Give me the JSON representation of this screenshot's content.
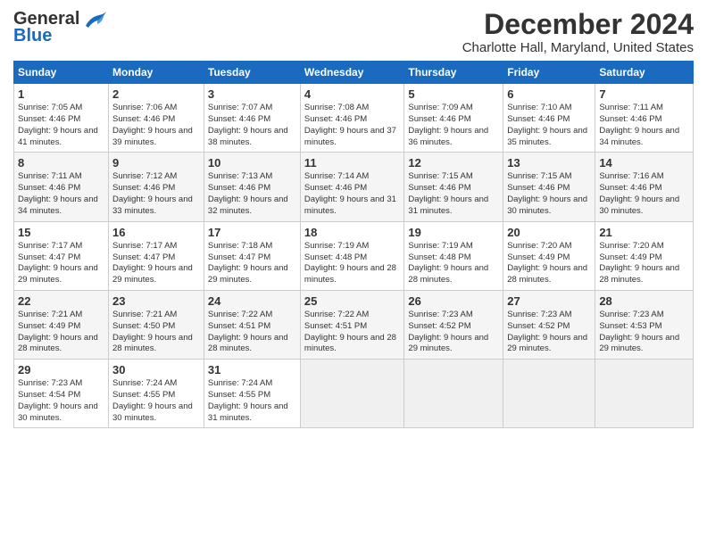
{
  "logo": {
    "line1": "General",
    "line2": "Blue"
  },
  "title": "December 2024",
  "subtitle": "Charlotte Hall, Maryland, United States",
  "days_header": [
    "Sunday",
    "Monday",
    "Tuesday",
    "Wednesday",
    "Thursday",
    "Friday",
    "Saturday"
  ],
  "rows": [
    [
      {
        "day": "1",
        "sunrise": "7:05 AM",
        "sunset": "4:46 PM",
        "daylight": "9 hours and 41 minutes."
      },
      {
        "day": "2",
        "sunrise": "7:06 AM",
        "sunset": "4:46 PM",
        "daylight": "9 hours and 39 minutes."
      },
      {
        "day": "3",
        "sunrise": "7:07 AM",
        "sunset": "4:46 PM",
        "daylight": "9 hours and 38 minutes."
      },
      {
        "day": "4",
        "sunrise": "7:08 AM",
        "sunset": "4:46 PM",
        "daylight": "9 hours and 37 minutes."
      },
      {
        "day": "5",
        "sunrise": "7:09 AM",
        "sunset": "4:46 PM",
        "daylight": "9 hours and 36 minutes."
      },
      {
        "day": "6",
        "sunrise": "7:10 AM",
        "sunset": "4:46 PM",
        "daylight": "9 hours and 35 minutes."
      },
      {
        "day": "7",
        "sunrise": "7:11 AM",
        "sunset": "4:46 PM",
        "daylight": "9 hours and 34 minutes."
      }
    ],
    [
      {
        "day": "8",
        "sunrise": "7:11 AM",
        "sunset": "4:46 PM",
        "daylight": "9 hours and 34 minutes."
      },
      {
        "day": "9",
        "sunrise": "7:12 AM",
        "sunset": "4:46 PM",
        "daylight": "9 hours and 33 minutes."
      },
      {
        "day": "10",
        "sunrise": "7:13 AM",
        "sunset": "4:46 PM",
        "daylight": "9 hours and 32 minutes."
      },
      {
        "day": "11",
        "sunrise": "7:14 AM",
        "sunset": "4:46 PM",
        "daylight": "9 hours and 31 minutes."
      },
      {
        "day": "12",
        "sunrise": "7:15 AM",
        "sunset": "4:46 PM",
        "daylight": "9 hours and 31 minutes."
      },
      {
        "day": "13",
        "sunrise": "7:15 AM",
        "sunset": "4:46 PM",
        "daylight": "9 hours and 30 minutes."
      },
      {
        "day": "14",
        "sunrise": "7:16 AM",
        "sunset": "4:46 PM",
        "daylight": "9 hours and 30 minutes."
      }
    ],
    [
      {
        "day": "15",
        "sunrise": "7:17 AM",
        "sunset": "4:47 PM",
        "daylight": "9 hours and 29 minutes."
      },
      {
        "day": "16",
        "sunrise": "7:17 AM",
        "sunset": "4:47 PM",
        "daylight": "9 hours and 29 minutes."
      },
      {
        "day": "17",
        "sunrise": "7:18 AM",
        "sunset": "4:47 PM",
        "daylight": "9 hours and 29 minutes."
      },
      {
        "day": "18",
        "sunrise": "7:19 AM",
        "sunset": "4:48 PM",
        "daylight": "9 hours and 28 minutes."
      },
      {
        "day": "19",
        "sunrise": "7:19 AM",
        "sunset": "4:48 PM",
        "daylight": "9 hours and 28 minutes."
      },
      {
        "day": "20",
        "sunrise": "7:20 AM",
        "sunset": "4:49 PM",
        "daylight": "9 hours and 28 minutes."
      },
      {
        "day": "21",
        "sunrise": "7:20 AM",
        "sunset": "4:49 PM",
        "daylight": "9 hours and 28 minutes."
      }
    ],
    [
      {
        "day": "22",
        "sunrise": "7:21 AM",
        "sunset": "4:49 PM",
        "daylight": "9 hours and 28 minutes."
      },
      {
        "day": "23",
        "sunrise": "7:21 AM",
        "sunset": "4:50 PM",
        "daylight": "9 hours and 28 minutes."
      },
      {
        "day": "24",
        "sunrise": "7:22 AM",
        "sunset": "4:51 PM",
        "daylight": "9 hours and 28 minutes."
      },
      {
        "day": "25",
        "sunrise": "7:22 AM",
        "sunset": "4:51 PM",
        "daylight": "9 hours and 28 minutes."
      },
      {
        "day": "26",
        "sunrise": "7:23 AM",
        "sunset": "4:52 PM",
        "daylight": "9 hours and 29 minutes."
      },
      {
        "day": "27",
        "sunrise": "7:23 AM",
        "sunset": "4:52 PM",
        "daylight": "9 hours and 29 minutes."
      },
      {
        "day": "28",
        "sunrise": "7:23 AM",
        "sunset": "4:53 PM",
        "daylight": "9 hours and 29 minutes."
      }
    ],
    [
      {
        "day": "29",
        "sunrise": "7:23 AM",
        "sunset": "4:54 PM",
        "daylight": "9 hours and 30 minutes."
      },
      {
        "day": "30",
        "sunrise": "7:24 AM",
        "sunset": "4:55 PM",
        "daylight": "9 hours and 30 minutes."
      },
      {
        "day": "31",
        "sunrise": "7:24 AM",
        "sunset": "4:55 PM",
        "daylight": "9 hours and 31 minutes."
      },
      null,
      null,
      null,
      null
    ]
  ],
  "labels": {
    "sunrise": "Sunrise:",
    "sunset": "Sunset:",
    "daylight": "Daylight:"
  }
}
